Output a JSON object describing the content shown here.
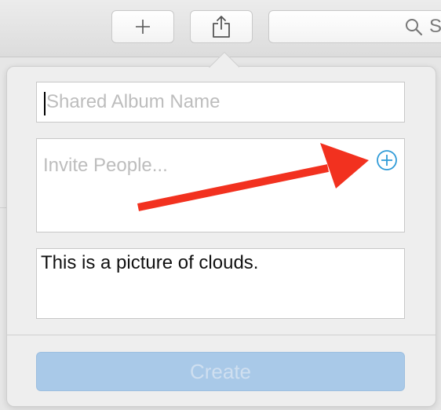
{
  "toolbar": {
    "add_icon": "plus-icon",
    "share_icon": "share-icon",
    "search_icon": "search-icon",
    "search_text": "S"
  },
  "form": {
    "album_name_placeholder": "Shared Album Name",
    "album_name_value": "",
    "invite_placeholder": "Invite People...",
    "add_person_icon": "plus-circle-icon",
    "comment_value": "This is a picture of clouds.",
    "create_label": "Create"
  },
  "colors": {
    "accent_blue": "#2f9bd8",
    "annotation_red": "#f2311f",
    "create_disabled": "#a9c9e8"
  }
}
